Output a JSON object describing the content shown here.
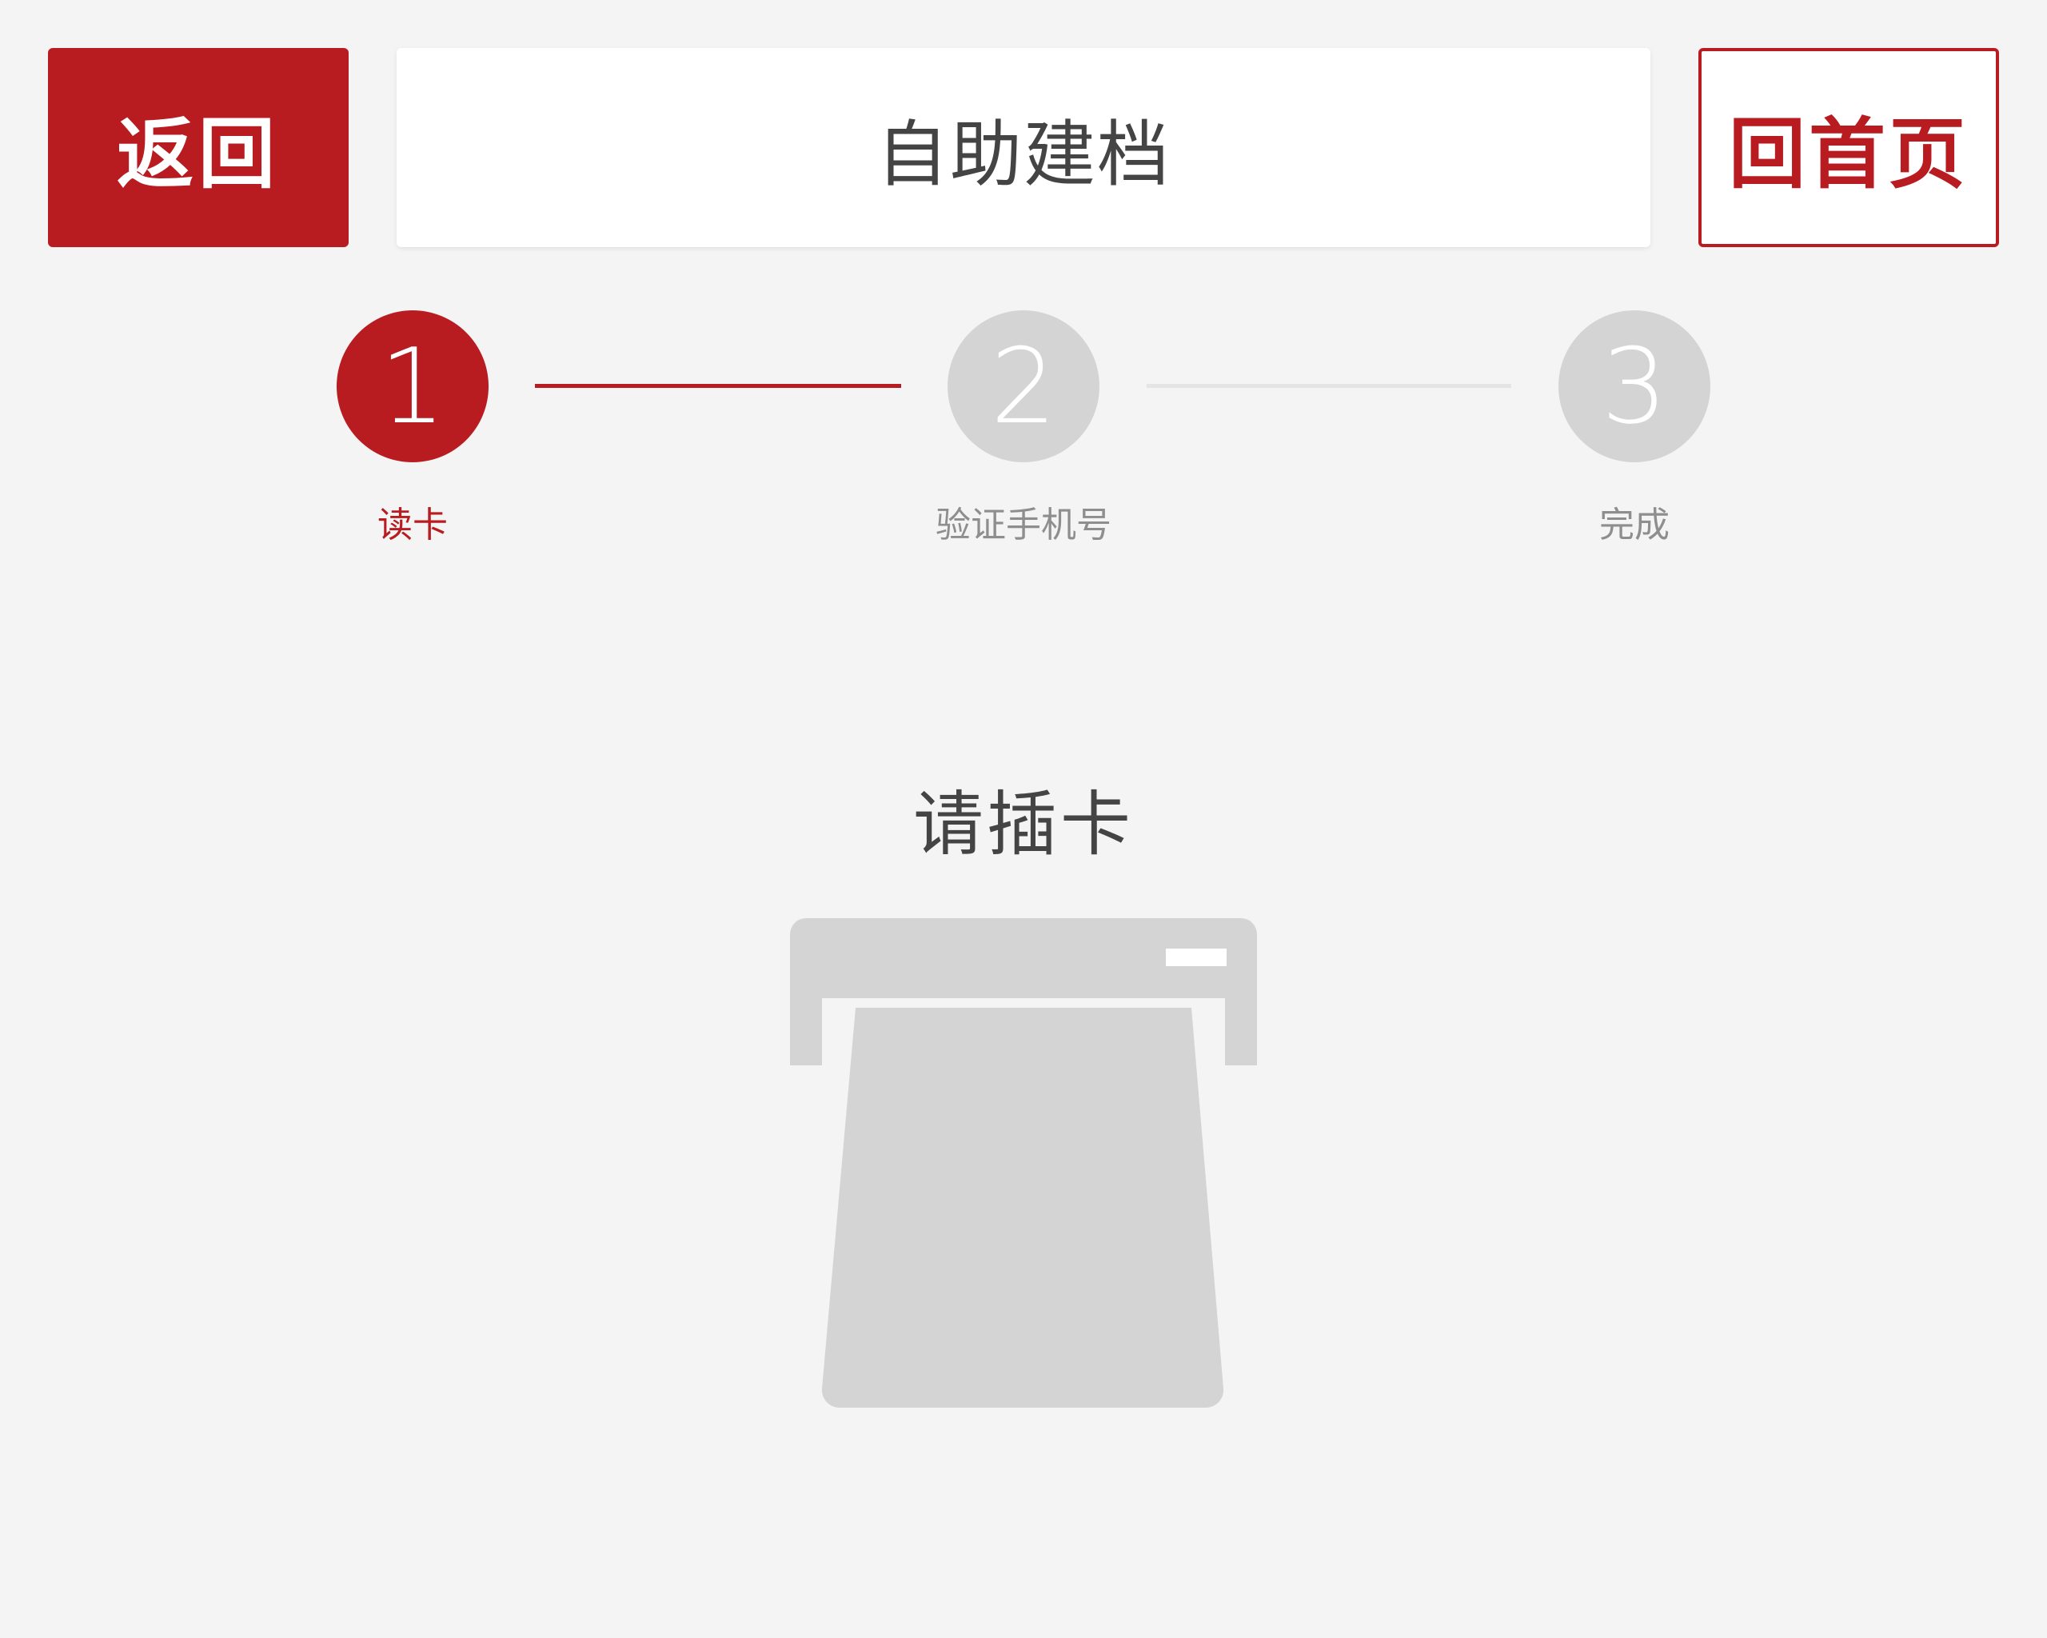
{
  "header": {
    "back_label": "返回",
    "title": "自助建档",
    "home_label": "回首页"
  },
  "steps": [
    {
      "number": "1",
      "label": "读卡",
      "state": "active"
    },
    {
      "number": "2",
      "label": "验证手机号",
      "state": "inactive"
    },
    {
      "number": "3",
      "label": "完成",
      "state": "inactive"
    }
  ],
  "main": {
    "prompt": "请插卡",
    "illustration_icon": "card-reader-icon"
  },
  "colors": {
    "accent": "#b81c20",
    "inactive": "#d4d4d4",
    "background": "#f4f4f4",
    "illustration": "#d4d4d4"
  }
}
